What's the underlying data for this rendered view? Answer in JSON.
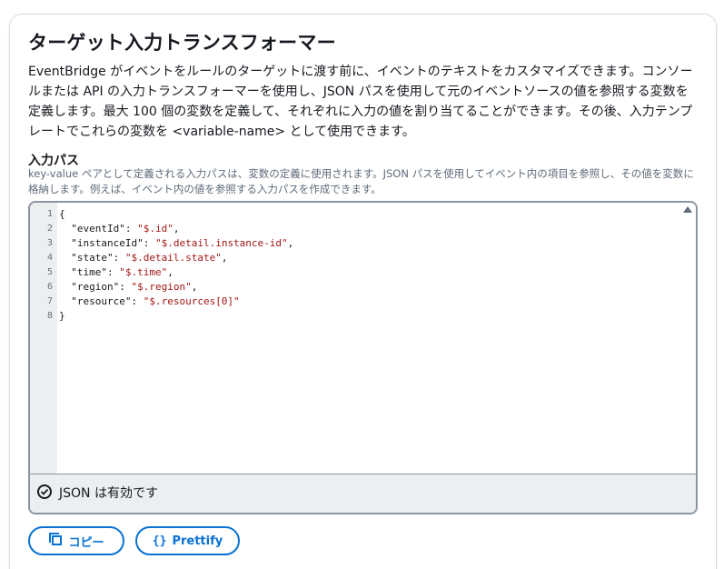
{
  "section": {
    "title": "ターゲット入力トランスフォーマー",
    "description": "EventBridge がイベントをルールのターゲットに渡す前に、イベントのテキストをカスタマイズできます。コンソールまたは API の入力トランスフォーマーを使用し、JSON パスを使用して元のイベントソースの値を参照する変数を定義します。最大 100 個の変数を定義して、それぞれに入力の値を割り当てることができます。その後、入力テンプレートでこれらの変数を <variable-name> として使用できます。"
  },
  "input_path": {
    "label": "入力パス",
    "description": "key-value ペアとして定義される入力パスは、変数の定義に使用されます。JSON パスを使用してイベント内の項目を参照し、その値を変数に格納します。例えば、イベント内の値を参照する入力パスを作成できます。"
  },
  "editor": {
    "lines": [
      {
        "num": "1",
        "key": "",
        "value": "",
        "text": "{"
      },
      {
        "num": "2",
        "key": "\"eventId\"",
        "value": "\"$.id\"",
        "text": ","
      },
      {
        "num": "3",
        "key": "\"instanceId\"",
        "value": "\"$.detail.instance-id\"",
        "text": ","
      },
      {
        "num": "4",
        "key": "\"state\"",
        "value": "\"$.detail.state\"",
        "text": ","
      },
      {
        "num": "5",
        "key": "\"time\"",
        "value": "\"$.time\"",
        "text": ","
      },
      {
        "num": "6",
        "key": "\"region\"",
        "value": "\"$.region\"",
        "text": ","
      },
      {
        "num": "7",
        "key": "\"resource\"",
        "value": "\"$.resources[0]\"",
        "text": ""
      },
      {
        "num": "8",
        "key": "",
        "value": "",
        "text": "}"
      }
    ],
    "status": "JSON は有効です",
    "status_icon": "check-circle-icon"
  },
  "buttons": {
    "copy_label": "コピー",
    "copy_icon": "copy-icon",
    "prettify_label": "Prettify",
    "prettify_icon": "braces-icon"
  },
  "colors": {
    "accent": "#0972d3",
    "string": "#a31515",
    "gutter": "#eceeef"
  }
}
